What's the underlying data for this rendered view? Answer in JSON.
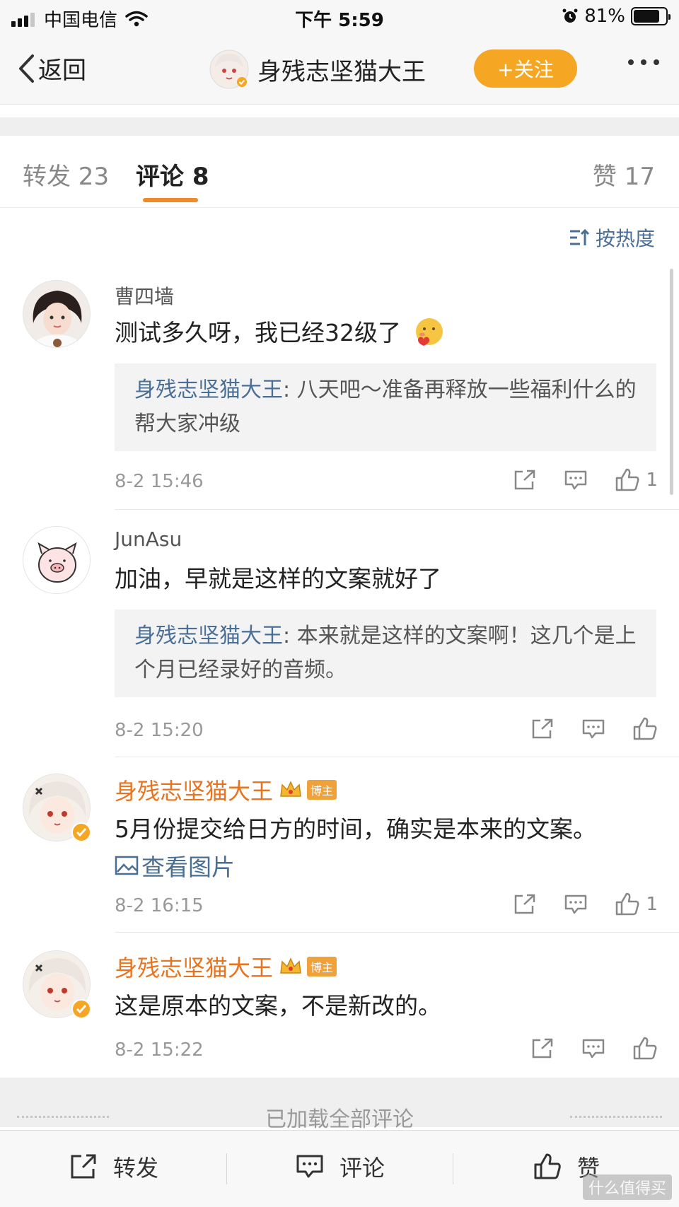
{
  "status_bar": {
    "carrier": "中国电信",
    "time": "下午 5:59",
    "battery": "81%",
    "battery_level": 0.81
  },
  "nav": {
    "back_label": "返回",
    "user_name": "身残志坚猫大王",
    "follow_label": "+关注"
  },
  "tabs": {
    "repost": "转发 23",
    "comment": "评论 8",
    "like": "赞 17"
  },
  "sort_label": "按热度",
  "comments": [
    {
      "user": "曹四墙",
      "text": "测试多久呀，我已经32级了",
      "reply_name": "身残志坚猫大王",
      "reply_text": ": 八天吧～准备再释放一些福利什么的帮大家冲级",
      "time": "8-2 15:46",
      "likes": "1"
    },
    {
      "user": "JunAsu",
      "text": "加油，早就是这样的文案就好了",
      "reply_name": "身残志坚猫大王",
      "reply_text": ": 本来就是这样的文案啊！这几个是上个月已经录好的音频。",
      "time": "8-2 15:20",
      "likes": ""
    },
    {
      "user": "身残志坚猫大王",
      "badge": "博主",
      "text": "5月份提交给日方的时间，确实是本来的文案。",
      "view_pic": "查看图片",
      "time": "8-2 16:15",
      "likes": "1"
    },
    {
      "user": "身残志坚猫大王",
      "badge": "博主",
      "text": "这是原本的文案，不是新改的。",
      "time": "8-2 15:22",
      "likes": ""
    }
  ],
  "loaded_label": "已加载全部评论",
  "bottom_bar": {
    "repost": "转发",
    "comment": "评论",
    "like": "赞"
  },
  "watermark": "什么值得买"
}
